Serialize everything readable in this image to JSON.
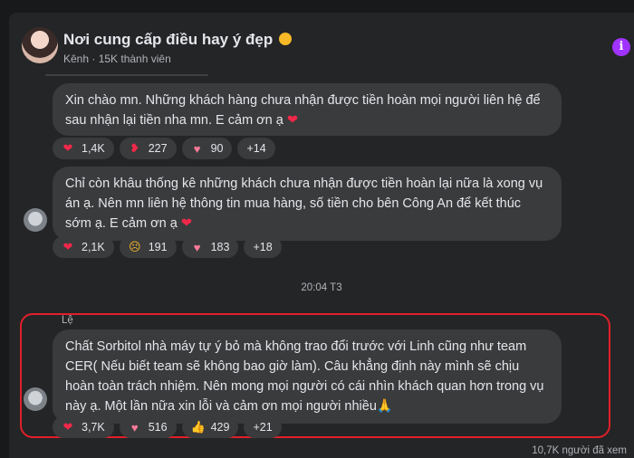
{
  "group": {
    "name": "Nơi cung cấp điều hay ý đẹp",
    "meta": "Kênh · 15K thành viên"
  },
  "messages": [
    {
      "text": "Xin chào mn. Những khách hàng chưa nhận được tiền hoàn mọi người liên hệ để sau nhận lại tiền nha mn. E cảm ơn ạ",
      "reactions": [
        {
          "icon": "red-heart-icon",
          "count": "1,4K"
        },
        {
          "icon": "heart-on-fire-icon",
          "count": "227"
        },
        {
          "icon": "pink-heart-icon",
          "count": "90"
        },
        {
          "icon": "",
          "count": "+14"
        }
      ]
    },
    {
      "text": "Chỉ còn khâu thống kê những khách chưa nhận được tiền hoàn lại nữa là xong vụ án ạ. Nên mn liên hệ thông tin mua hàng, số tiền cho bên Công An để kết thúc sớm ạ. E cảm ơn ạ",
      "reactions": [
        {
          "icon": "red-heart-icon",
          "count": "2,1K"
        },
        {
          "icon": "sad-face-icon",
          "count": "191"
        },
        {
          "icon": "pink-heart-icon",
          "count": "183"
        },
        {
          "icon": "",
          "count": "+18"
        }
      ]
    },
    {
      "sender": "Lệ",
      "text": "Chất Sorbitol nhà máy tự ý bỏ mà không trao đổi trước với Linh cũng như team CER( Nếu biết team sẽ không bao giờ làm). Câu khẳng định này mình sẽ chịu hoàn toàn trách nhiệm. Nên mong mọi người có cái nhìn khách quan hơn trong vụ này ạ. Một lần nữa xin lỗi và cảm ơn mọi người nhiều",
      "reactions": [
        {
          "icon": "red-heart-icon",
          "count": "3,7K"
        },
        {
          "icon": "pink-heart-icon",
          "count": "516"
        },
        {
          "icon": "thumbs-up-icon",
          "count": "429"
        },
        {
          "icon": "",
          "count": "+21"
        }
      ]
    }
  ],
  "timestamp": "20:04 T3",
  "seen_by": "10,7K người đã xem",
  "colors": {
    "highlight": "#e0202a",
    "accent": "#a033ff"
  }
}
